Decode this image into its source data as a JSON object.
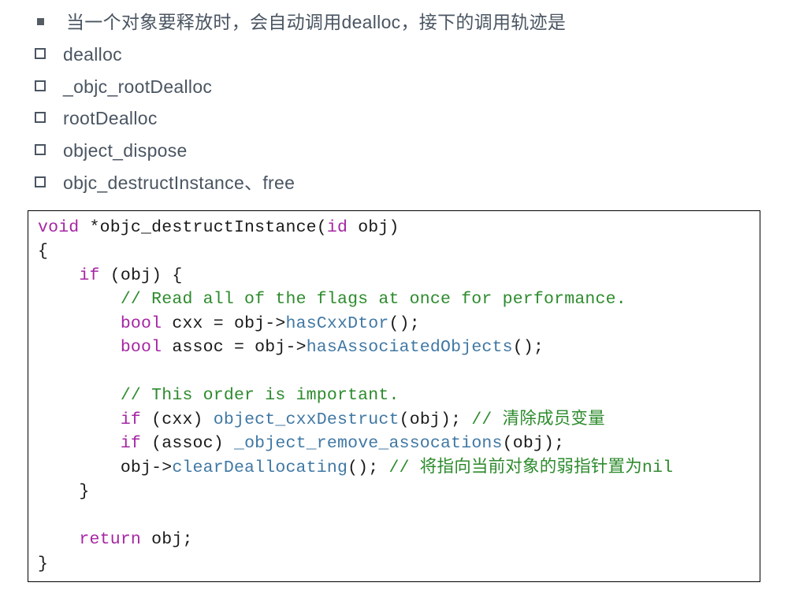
{
  "list": {
    "items": [
      {
        "bullet": "filled",
        "text": "当一个对象要释放时，会自动调用dealloc，接下的调用轨迹是"
      },
      {
        "bullet": "hollow",
        "text": "dealloc"
      },
      {
        "bullet": "hollow",
        "text": "_objc_rootDealloc"
      },
      {
        "bullet": "hollow",
        "text": "rootDealloc"
      },
      {
        "bullet": "hollow",
        "text": "object_dispose"
      },
      {
        "bullet": "hollow",
        "text": "objc_destructInstance、free"
      }
    ]
  },
  "code": {
    "l1_kw": "void",
    "l1_rest": " *objc_destructInstance(",
    "l1_kw2": "id",
    "l1_rest2": " obj)",
    "l2": "{",
    "l3_indent": "    ",
    "l3_kw": "if",
    "l3_rest": " (obj) {",
    "l4_indent": "        ",
    "l4_comment": "// Read all of the flags at once for performance.",
    "l5_indent": "        ",
    "l5_kw": "bool",
    "l5_rest": " cxx = obj->",
    "l5_call": "hasCxxDtor",
    "l5_rest2": "();",
    "l6_indent": "        ",
    "l6_kw": "bool",
    "l6_rest": " assoc = obj->",
    "l6_call": "hasAssociatedObjects",
    "l6_rest2": "();",
    "l7": "",
    "l8_indent": "        ",
    "l8_comment": "// This order is important.",
    "l9_indent": "        ",
    "l9_kw": "if",
    "l9_rest": " (cxx) ",
    "l9_call": "object_cxxDestruct",
    "l9_rest2": "(obj); ",
    "l9_comment": "// 清除成员变量",
    "l10_indent": "        ",
    "l10_kw": "if",
    "l10_rest": " (assoc) ",
    "l10_call": "_object_remove_assocations",
    "l10_rest2": "(obj);",
    "l11_indent": "        obj->",
    "l11_call": "clearDeallocating",
    "l11_rest": "(); ",
    "l11_comment": "// 将指向当前对象的弱指针置为nil",
    "l12_indent": "    }",
    "l13": "",
    "l14_indent": "    ",
    "l14_kw": "return",
    "l14_rest": " obj;",
    "l15": "}"
  }
}
